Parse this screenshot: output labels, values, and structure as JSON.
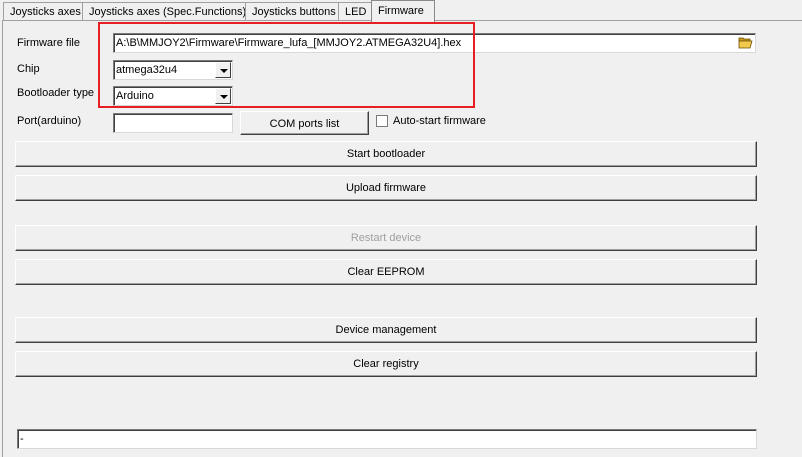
{
  "tabs": [
    {
      "label": "Joysticks axes"
    },
    {
      "label": "Joysticks axes (Spec.Functions)"
    },
    {
      "label": "Joysticks buttons"
    },
    {
      "label": "LED"
    },
    {
      "label": "Firmware"
    }
  ],
  "firmware": {
    "firmware_file_label": "Firmware file",
    "firmware_file_value": "A:\\B\\MMJOY2\\Firmware\\Firmware_lufa_[MMJOY2.ATMEGA32U4].hex",
    "chip_label": "Chip",
    "chip_value": "atmega32u4",
    "bootloader_label": "Bootloader type",
    "bootloader_value": "Arduino",
    "port_label": "Port(arduino)",
    "port_value": "",
    "com_ports_button": "COM ports list",
    "auto_start_label": "Auto-start firmware",
    "start_bootloader_button": "Start bootloader",
    "upload_firmware_button": "Upload firmware",
    "restart_device_button": "Restart device",
    "clear_eeprom_button": "Clear EEPROM",
    "device_management_button": "Device management",
    "clear_registry_button": "Clear registry",
    "status_value": "-"
  },
  "colors": {
    "highlight": "#e81e25",
    "background": "#f0f0f0"
  }
}
